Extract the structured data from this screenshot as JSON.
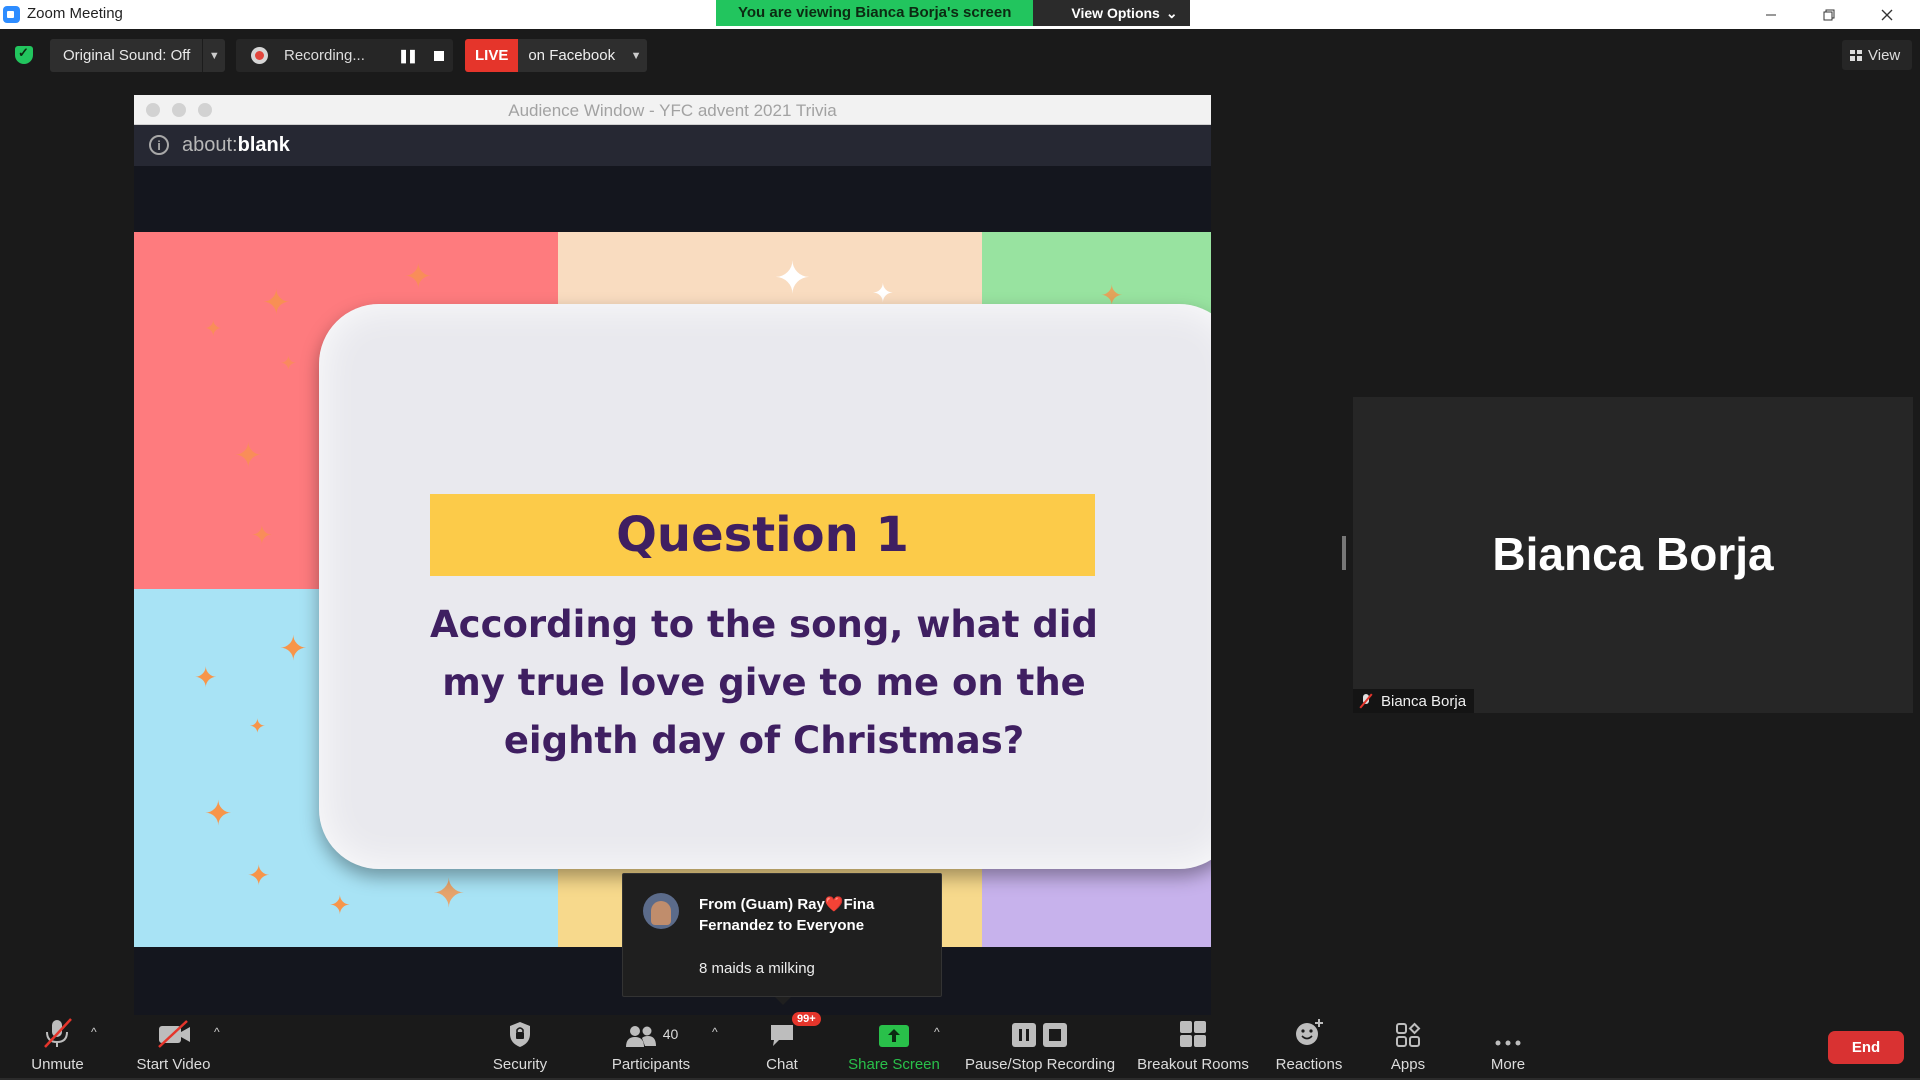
{
  "window": {
    "title": "Zoom Meeting",
    "banner_text": "You are viewing Bianca Borja's screen",
    "view_options_label": "View Options"
  },
  "topbar": {
    "original_sound_label": "Original Sound: Off",
    "recording_label": "Recording...",
    "live_label": "LIVE",
    "live_target": "on Facebook",
    "view_label": "View"
  },
  "shared_window": {
    "title": "Audience Window - YFC advent 2021 Trivia",
    "url_prefix": "about:",
    "url_page": "blank"
  },
  "slide": {
    "question_title": "Question 1",
    "question_text": "According to the song, what did my true love give to me on the eighth day of Christmas?",
    "colors": {
      "panel_red": "#fe7b7e",
      "panel_peach": "#f9dcc0",
      "panel_green": "#98e3a0",
      "panel_blue": "#a8e3f5",
      "panel_yellow": "#f7d98c",
      "panel_purple": "#c7b2ec",
      "band": "#fccb49",
      "text": "#3f1f61",
      "star": "#f7954a"
    }
  },
  "chat_toast": {
    "from": "From (Guam) Ray❤️Fina Fernandez to Everyone",
    "message": "8 maids a milking"
  },
  "participant": {
    "display_name": "Bianca Borja",
    "name_label": "Bianca Borja",
    "muted": true
  },
  "toolbar": {
    "unmute": "Unmute",
    "start_video": "Start Video",
    "security": "Security",
    "participants": "Participants",
    "participants_count": "40",
    "chat": "Chat",
    "chat_badge": "99+",
    "share_screen": "Share Screen",
    "pause_stop_recording": "Pause/Stop Recording",
    "breakout_rooms": "Breakout Rooms",
    "reactions": "Reactions",
    "apps": "Apps",
    "more": "More",
    "end": "End"
  },
  "accent_colors": {
    "banner_green": "#22c55e",
    "live_red": "#e5352b",
    "share_green": "#29c04a",
    "end_red": "#d93232"
  }
}
